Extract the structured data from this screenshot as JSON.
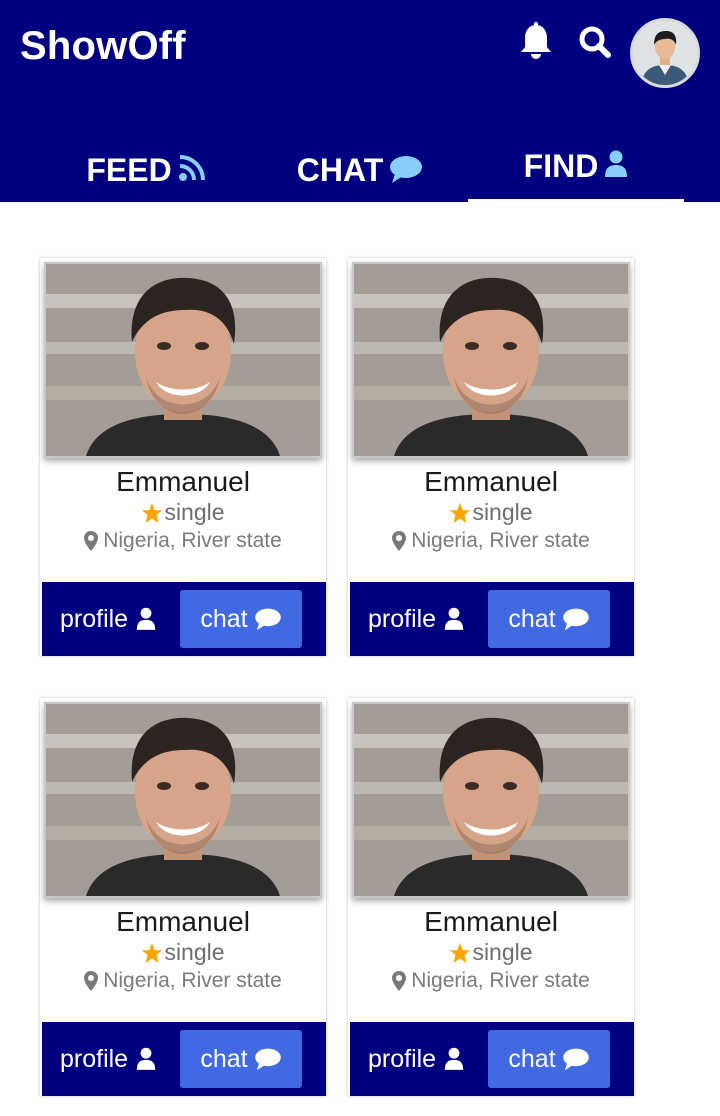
{
  "app": {
    "title": "ShowOff"
  },
  "header": {
    "icons": [
      "bell-icon",
      "search-icon"
    ],
    "avatar": "user-avatar"
  },
  "tabs": [
    {
      "label": "FEED",
      "icon": "rss-icon"
    },
    {
      "label": "CHAT",
      "icon": "comment-icon"
    },
    {
      "label": "FIND",
      "icon": "user-icon",
      "active": true
    }
  ],
  "colors": {
    "primary": "#000080",
    "button": "#4169e1",
    "star": "#ffa500"
  },
  "cards": [
    {
      "name": "Emmanuel",
      "status": "single",
      "location": "Nigeria, River state",
      "profile_label": "profile",
      "chat_label": "chat"
    },
    {
      "name": "Emmanuel",
      "status": "single",
      "location": "Nigeria, River state",
      "profile_label": "profile",
      "chat_label": "chat"
    },
    {
      "name": "Emmanuel",
      "status": "single",
      "location": "Nigeria, River state",
      "profile_label": "profile",
      "chat_label": "chat"
    },
    {
      "name": "Emmanuel",
      "status": "single",
      "location": "Nigeria, River state",
      "profile_label": "profile",
      "chat_label": "chat"
    }
  ]
}
